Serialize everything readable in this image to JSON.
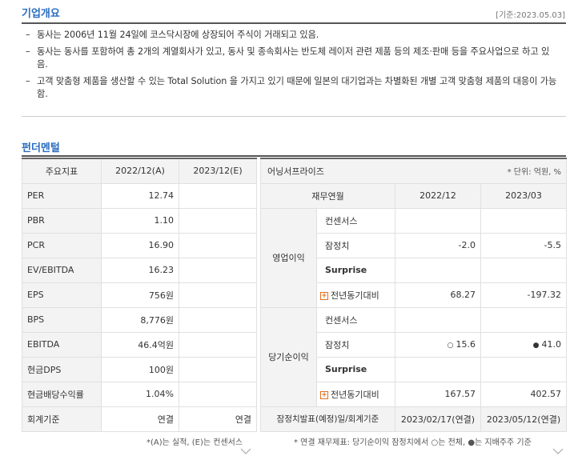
{
  "overview": {
    "title": "기업개요",
    "base_date": "[기준:2023.05.03]",
    "bullets": [
      "동사는 2006년 11월 24일에 코스닥시장에 상장되어 주식이 거래되고 있음.",
      "동사는 동사를 포함하여 총 2개의 계열회사가 있고, 동사 및 종속회사는 반도체 레이저 관련 제품 등의 제조·판매 등을 주요사업으로 하고 있음.",
      "고객 맞춤형 제품을 생산할 수 있는 Total Solution 을 가지고 있기 때문에 일본의 대기업과는 차별화된 개별 고객 맞춤형 제품의 대응이 가능함."
    ]
  },
  "fundamentals": {
    "title": "펀더멘털",
    "left": {
      "headers": [
        "주요지표",
        "2022/12(A)",
        "2023/12(E)"
      ],
      "rows": [
        {
          "label": "PER",
          "a": "12.74",
          "e": ""
        },
        {
          "label": "PBR",
          "a": "1.10",
          "e": ""
        },
        {
          "label": "PCR",
          "a": "16.90",
          "e": ""
        },
        {
          "label": "EV/EBITDA",
          "a": "16.23",
          "e": ""
        },
        {
          "label": "EPS",
          "a": "756원",
          "e": ""
        },
        {
          "label": "BPS",
          "a": "8,776원",
          "e": ""
        },
        {
          "label": "EBITDA",
          "a": "46.4억원",
          "e": ""
        },
        {
          "label": "현금DPS",
          "a": "100원",
          "e": ""
        },
        {
          "label": "현금배당수익률",
          "a": "1.04%",
          "e": ""
        },
        {
          "label": "회계기준",
          "a": "연결",
          "e": "연결"
        }
      ],
      "note": "*(A)는 실적, (E)는 컨센서스"
    },
    "right": {
      "title": "어닝서프라이즈",
      "unit": "* 단위: 억원, %",
      "headers": [
        "재무연월",
        "2022/12",
        "2023/03"
      ],
      "op_group": "영업이익",
      "net_group": "당기순이익",
      "op_rows": [
        {
          "label": "컨센서스",
          "v1": "",
          "v2": ""
        },
        {
          "label": "잠정치",
          "v1": "-2.0",
          "v2": "-5.5"
        },
        {
          "label": "Surprise",
          "v1": "",
          "v2": ""
        },
        {
          "label": "전년동기대비",
          "v1": "68.27",
          "v2": "-197.32"
        }
      ],
      "net_rows": [
        {
          "label": "컨센서스",
          "v1": "",
          "v2": ""
        },
        {
          "label": "잠정치",
          "v1": "15.6",
          "v2": "41.0",
          "d1": "○",
          "d2": "●"
        },
        {
          "label": "Surprise",
          "v1": "",
          "v2": ""
        },
        {
          "label": "전년동기대비",
          "v1": "167.57",
          "v2": "402.57"
        }
      ],
      "last": {
        "label": "잠정치발표(예정)일/회계기준",
        "v1": "2023/02/17(연결)",
        "v2": "2023/05/12(연결)"
      },
      "note": "* 연결 재무제표: 당기순이익 잠정치에서 ○는 전체, ●는 지배주주 기준"
    }
  }
}
